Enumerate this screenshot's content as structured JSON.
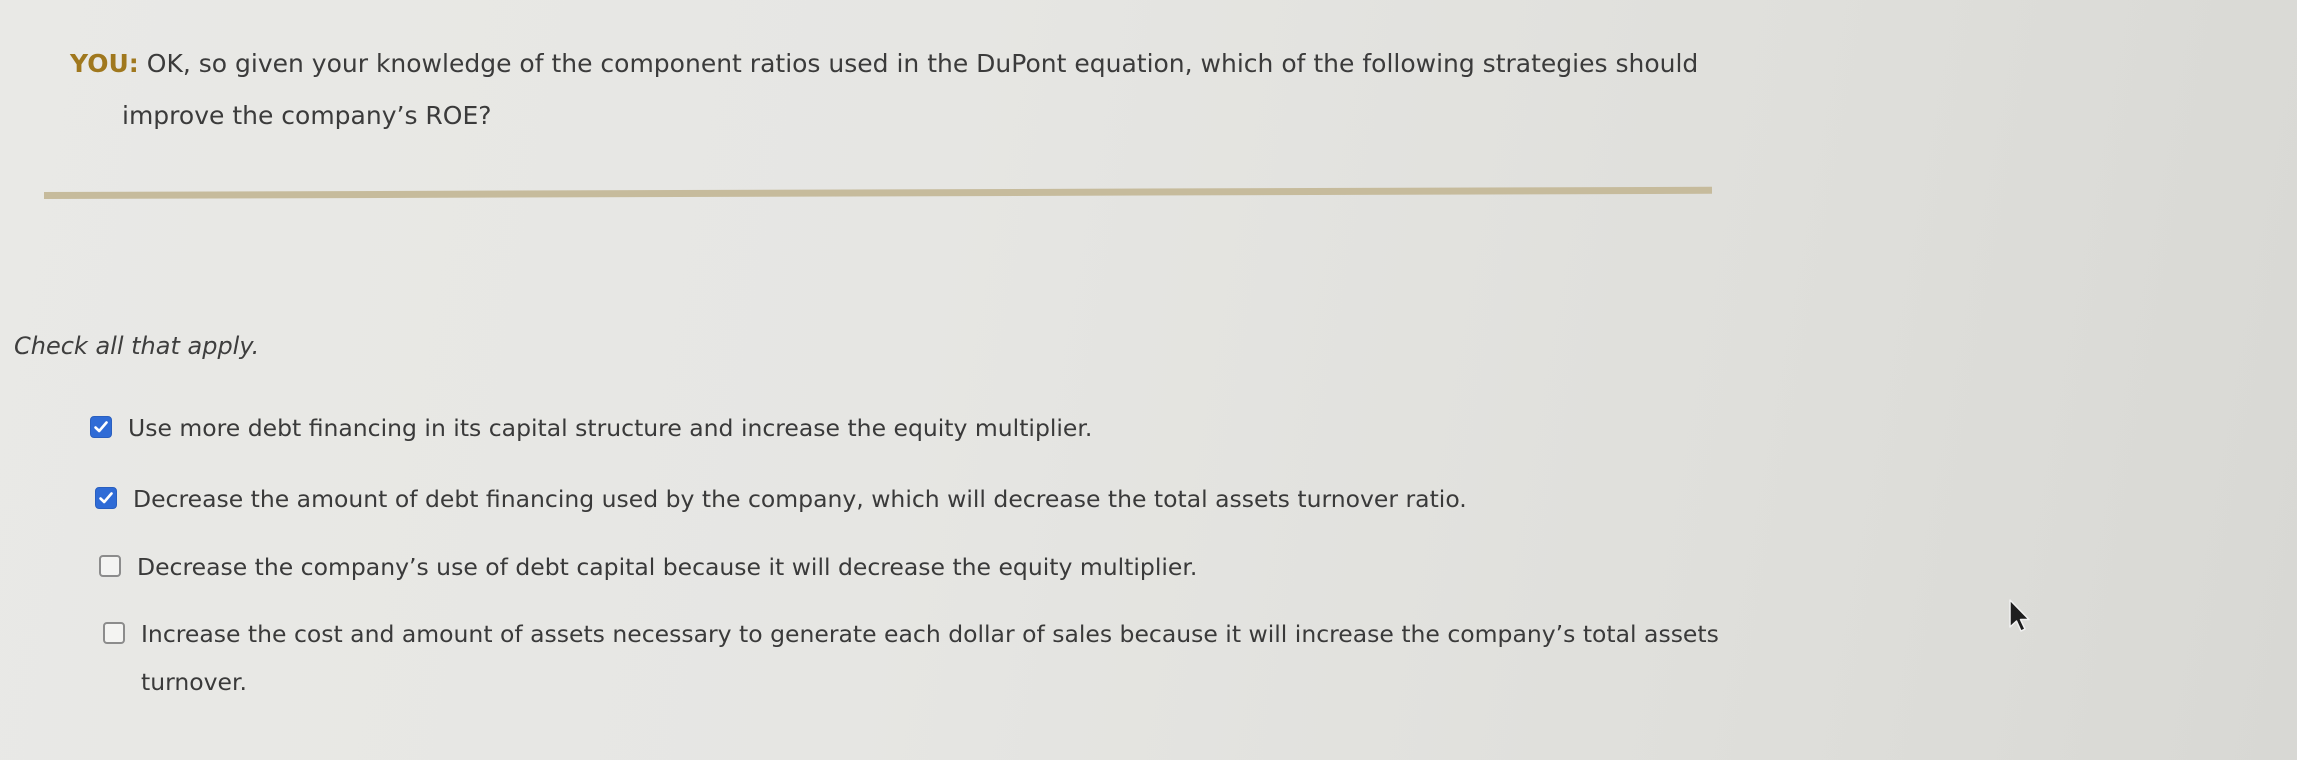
{
  "question": {
    "speaker": "YOU:",
    "line1": "OK, so given your knowledge of the component ratios used in the DuPont equation, which of the following strategies should",
    "line2": "improve the company’s ROE?"
  },
  "instructions": "Check all that apply.",
  "options": [
    {
      "checked": true,
      "text": "Use more debt financing in its capital structure and increase the equity multiplier."
    },
    {
      "checked": true,
      "text": "Decrease the amount of debt financing used by the company, which will decrease the total assets turnover ratio."
    },
    {
      "checked": false,
      "text": "Decrease the company’s use of debt capital because it will decrease the equity multiplier."
    },
    {
      "checked": false,
      "line1": "Increase the cost and amount of assets necessary to generate each dollar of sales because it will increase the company’s total assets",
      "line2": "turnover."
    }
  ],
  "colors": {
    "speaker": "#a0781e",
    "checkbox_checked": "#2f6bd6",
    "divider": "#c6bb9c"
  },
  "icons": {
    "checked": "checkmark-icon",
    "cursor": "mouse-pointer-icon"
  }
}
